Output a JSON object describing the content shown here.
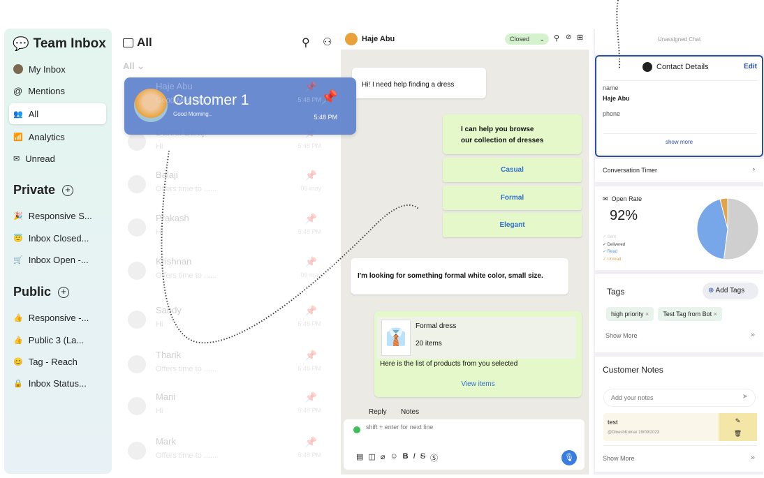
{
  "sidebar": {
    "title": "Team Inbox",
    "items": [
      {
        "label": "My Inbox",
        "icon": "avatar-icon"
      },
      {
        "label": "Mentions",
        "icon": "at-icon"
      },
      {
        "label": "All",
        "icon": "group-icon"
      },
      {
        "label": "Analytics",
        "icon": "chart-icon"
      },
      {
        "label": "Unread",
        "icon": "mail-icon"
      }
    ],
    "private": {
      "title": "Private",
      "items": [
        {
          "label": "Responsive S...",
          "emoji": "🎉"
        },
        {
          "label": "Inbox Closed...",
          "emoji": "😇"
        },
        {
          "label": "Inbox Open -...",
          "emoji": "🛒"
        }
      ]
    },
    "public": {
      "title": "Public",
      "items": [
        {
          "label": "Responsive -...",
          "emoji": "👍"
        },
        {
          "label": "Public 3 (La...",
          "emoji": "👍"
        },
        {
          "label": "Tag - Reach",
          "emoji": "😊"
        },
        {
          "label": "Inbox Status...",
          "emoji": "🔒"
        }
      ]
    }
  },
  "list": {
    "title": "All",
    "filter": "All",
    "rows": [
      {
        "name": "Haje Abu",
        "preview": "Good Morning..",
        "time": "5:48 PM"
      },
      {
        "name": "Daniel Balaji",
        "preview": "Hi",
        "time": "5:48 PM"
      },
      {
        "name": "Balaji",
        "preview": "Offers time to ......",
        "time": "09 may"
      },
      {
        "name": "Prakash",
        "preview": "Hi",
        "time": "5:48 PM"
      },
      {
        "name": "Krishnan",
        "preview": "Offers time to ......",
        "time": "09 may"
      },
      {
        "name": "Sandy",
        "preview": "Hi",
        "time": "5:48 PM"
      },
      {
        "name": "Tharik",
        "preview": "Offers time to ......",
        "time": "5:48 PM"
      },
      {
        "name": "Mani",
        "preview": "Hi",
        "time": "5:48 PM"
      },
      {
        "name": "Mark",
        "preview": "Offers time to ......",
        "time": "5:48 PM"
      }
    ]
  },
  "dragged": {
    "name": "Customer 1",
    "preview": "Good Morning..",
    "time": "5:48 PM"
  },
  "chat": {
    "contact": "Haje Abu",
    "status": "Closed",
    "msg1": "Hi! I need help finding a dress",
    "msg2_line1": "I can help you browse",
    "msg2_line2": "our collection of dresses",
    "options": [
      "Casual",
      "Formal",
      "Elegant"
    ],
    "msg3": "I'm looking for something formal white color, small size.",
    "product": {
      "title": "Formal dress",
      "count": "20 items",
      "caption": "Here is the list of products from  you selected",
      "link": "View items"
    },
    "tabs": [
      "Reply",
      "Notes"
    ],
    "placeholder": "shift + enter for next line"
  },
  "right": {
    "header": "Unassigned Chat",
    "contact_title": "Contact Details",
    "edit": "Edit",
    "name_label": "name",
    "name_value": "Haje Abu",
    "phone_label": "phone",
    "show_more": "show more",
    "timer": "Conversation Timer",
    "open_rate": {
      "title": "Open Rate",
      "value": "92%",
      "legend": [
        "Sent",
        "Delivered",
        "Read",
        "Unread"
      ],
      "pie": [
        {
          "label": "Delivered",
          "value": 52,
          "color": "#cfcfcf"
        },
        {
          "label": "Read",
          "value": 44,
          "color": "#77a7e8"
        },
        {
          "label": "Unread",
          "value": 4,
          "color": "#e0a44e"
        }
      ]
    },
    "tags": {
      "title": "Tags",
      "add": "Add Tags",
      "items": [
        "high priority",
        "Test Tag from Bot"
      ],
      "show_more": "Show More"
    },
    "notes": {
      "title": "Customer Notes",
      "placeholder": "Add your notes",
      "note": "test",
      "meta": "@DineshKumar 19/09/2023",
      "show_more": "Show More"
    }
  }
}
